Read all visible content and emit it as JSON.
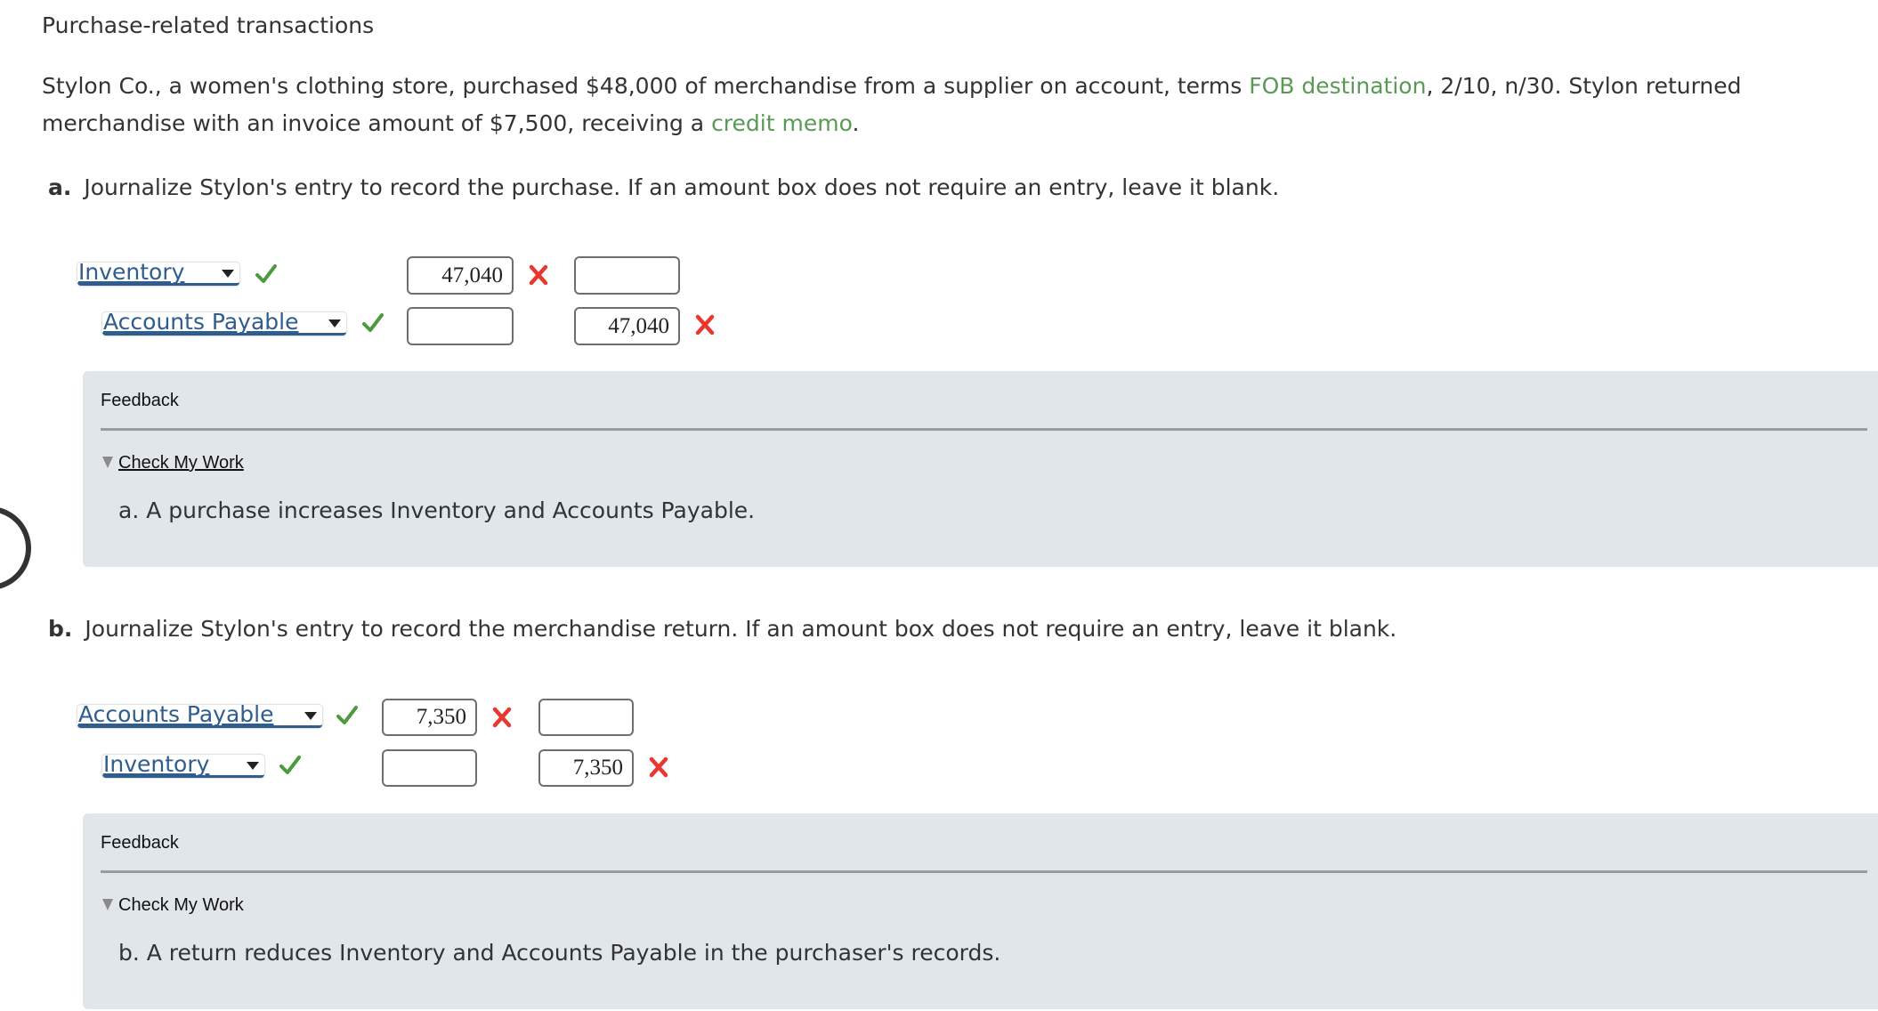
{
  "title": "Purchase-related transactions",
  "intro": {
    "part1": "Stylon Co., a women's clothing store, purchased $48,000 of merchandise from a supplier on account, terms ",
    "term1": "FOB destination",
    "part2": ", 2/10, n/30. Stylon returned merchandise with an invoice amount of $7,500, receiving a ",
    "term2": "credit memo",
    "part3": "."
  },
  "colors": {
    "link_green": "#5a9a55",
    "account_blue": "#2f5d8e",
    "correct_green": "#4b9a3e",
    "incorrect_red": "#e8372f",
    "feedback_bg": "#e0e6ea"
  },
  "questions": [
    {
      "label": "a.",
      "prompt": "Journalize Stylon's entry to record the purchase. If an amount box does not require an entry, leave it blank.",
      "rows": [
        {
          "account": "Inventory",
          "account_status": "correct",
          "debit": "47,040",
          "debit_status": "incorrect",
          "credit": "",
          "credit_status": ""
        },
        {
          "account": "Accounts Payable",
          "account_status": "correct",
          "debit": "",
          "debit_status": "",
          "credit": "47,040",
          "credit_status": "incorrect"
        }
      ],
      "feedback": {
        "heading": "Feedback",
        "toggle_label": "Check My Work",
        "explanation": "a. A purchase increases Inventory and Accounts Payable."
      }
    },
    {
      "label": "b.",
      "prompt": "Journalize Stylon's entry to record the merchandise return. If an amount box does not require an entry, leave it blank.",
      "rows": [
        {
          "account": "Accounts Payable",
          "account_status": "correct",
          "debit": "7,350",
          "debit_status": "incorrect",
          "credit": "",
          "credit_status": ""
        },
        {
          "account": "Inventory",
          "account_status": "correct",
          "debit": "",
          "debit_status": "",
          "credit": "7,350",
          "credit_status": "incorrect"
        }
      ],
      "feedback": {
        "heading": "Feedback",
        "toggle_label": "Check My Work",
        "explanation": "b. A return reduces Inventory and Accounts Payable in the purchaser's records."
      }
    }
  ]
}
